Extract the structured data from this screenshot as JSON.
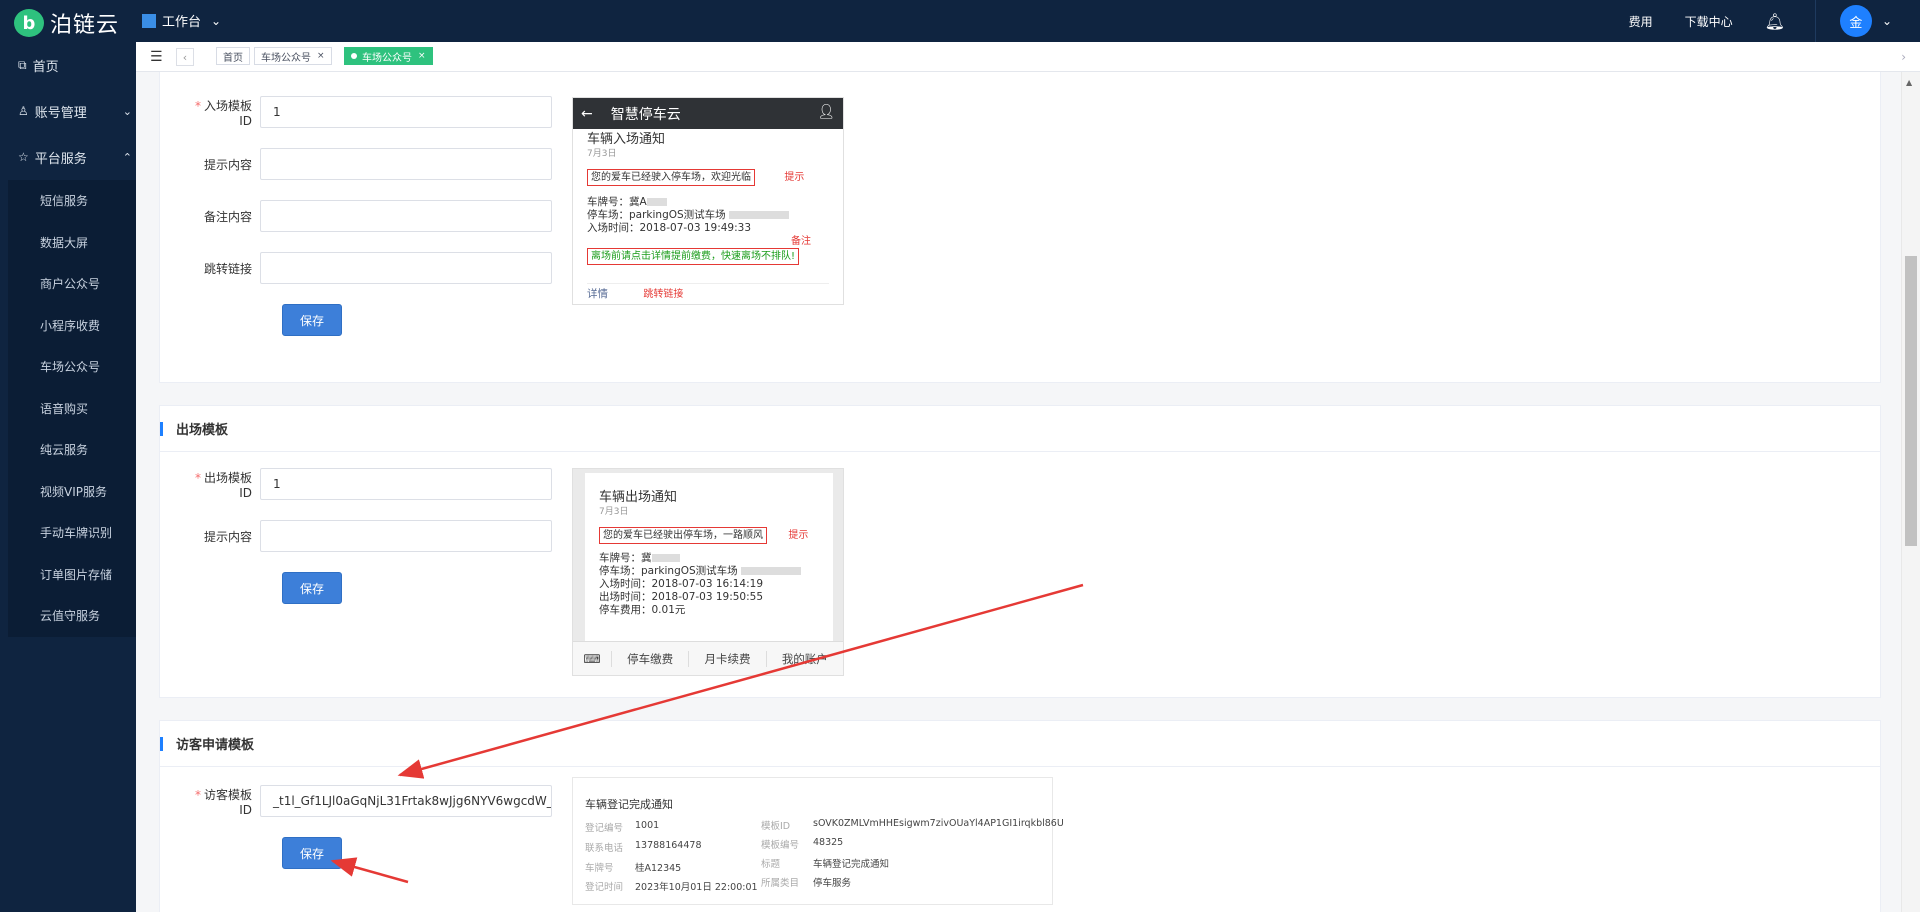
{
  "app": {
    "name": "泊链云",
    "workbench": "工作台"
  },
  "topbar": {
    "fee_label": "费用",
    "download_label": "下载中心",
    "avatar_initial": "金"
  },
  "sidebar": {
    "home": "首页",
    "account": "账号管理",
    "platform": "平台服务",
    "sub_items": [
      "短信服务",
      "数据大屏",
      "商户公众号",
      "小程序收费",
      "车场公众号",
      "语音购买",
      "纯云服务",
      "视频VIP服务",
      "手动车牌识别",
      "订单图片存储",
      "云值守服务"
    ]
  },
  "tabs": [
    {
      "label": "首页"
    },
    {
      "label": "车场公众号"
    },
    {
      "label": "车场公众号",
      "active": true
    }
  ],
  "entry": {
    "id_label": "入场模板ID",
    "id_value": "1",
    "tip_label": "提示内容",
    "remark_label": "备注内容",
    "link_label": "跳转链接",
    "save": "保存",
    "preview": {
      "header": "智慧停车云",
      "title": "车辆入场通知",
      "date": "7月3日",
      "tip": "您的爱车已经驶入停车场，欢迎光临",
      "tip_ann": "提示",
      "plate": "车牌号：冀A",
      "park": "停车场：parkingOS测试车场",
      "time": "入场时间：2018-07-03 19:49:33",
      "remark_ann": "备注",
      "remark": "离场前请点击详情提前缴费，快速离场不排队!",
      "detail": "详情",
      "link_ann": "跳转链接"
    }
  },
  "exit": {
    "section_title": "出场模板",
    "id_label": "出场模板ID",
    "id_value": "1",
    "tip_label": "提示内容",
    "save": "保存",
    "preview": {
      "title": "车辆出场通知",
      "date": "7月3日",
      "tip": "您的爱车已经驶出停车场，一路顺风",
      "tip_ann": "提示",
      "plate": "车牌号：冀",
      "park": "停车场：parkingOS测试车场",
      "in_time": "入场时间：2018-07-03 16:14:19",
      "out_time": "出场时间：2018-07-03 19:50:55",
      "fee": "停车费用：0.01元",
      "menu": [
        "停车缴费",
        "月卡续费",
        "我的账户"
      ]
    }
  },
  "visitor": {
    "section_title": "访客申请模板",
    "id_label": "访客模板ID",
    "id_value": "_t1l_Gf1LJl0aGqNjL31Frtak8wJjg6NYV6wgcdW_",
    "save": "保存",
    "preview": {
      "title": "车辆登记完成通知",
      "left": [
        {
          "k": "登记编号",
          "v": "1001"
        },
        {
          "k": "联系电话",
          "v": "13788164478"
        },
        {
          "k": "车牌号",
          "v": "桂A12345"
        },
        {
          "k": "登记时间",
          "v": "2023年10月01日 22:00:01"
        }
      ],
      "right": [
        {
          "k": "模板ID",
          "v": "sOVK0ZMLVmHHEsigwm7zivOUaYl4AP1GI1irqkbl86U"
        },
        {
          "k": "模板编号",
          "v": "48325"
        },
        {
          "k": "标题",
          "v": "车辆登记完成通知"
        },
        {
          "k": "所属类目",
          "v": "停车服务"
        }
      ]
    }
  },
  "colors": {
    "sidebar_bg": "#0f2440",
    "accent": "#2ec27e",
    "primary": "#3d7fd9",
    "annotation": "#e53935"
  }
}
